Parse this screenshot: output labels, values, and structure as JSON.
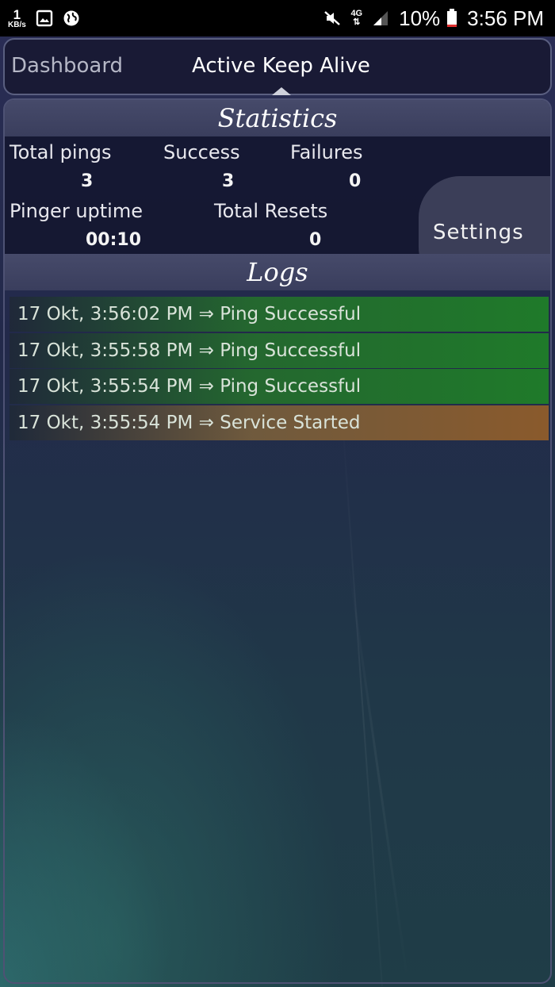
{
  "status_bar": {
    "speed_value": "1",
    "speed_unit": "KB/s",
    "network_type": "4G",
    "battery_percent": "10%",
    "clock": "3:56 PM",
    "icons": [
      "image-icon",
      "globe-icon",
      "mute-icon",
      "signal-icon",
      "battery-icon"
    ]
  },
  "nav": {
    "tabs": [
      {
        "label": "Dashboard",
        "active": false
      },
      {
        "label": "Active Keep Alive",
        "active": true
      }
    ]
  },
  "statistics": {
    "title": "Statistics",
    "total_pings": {
      "label": "Total pings",
      "value": "3"
    },
    "success": {
      "label": "Success",
      "value": "3"
    },
    "failures": {
      "label": "Failures",
      "value": "0"
    },
    "pinger_uptime": {
      "label": "Pinger uptime",
      "value": "00:10"
    },
    "total_resets": {
      "label": "Total Resets",
      "value": "0"
    },
    "settings_label": "Settings"
  },
  "logs": {
    "title": "Logs",
    "entries": [
      {
        "text": "17 Okt, 3:56:02 PM ⇒ Ping Successful",
        "status": "success"
      },
      {
        "text": "17 Okt, 3:55:58 PM ⇒ Ping Successful",
        "status": "success"
      },
      {
        "text": "17 Okt, 3:55:54 PM ⇒ Ping Successful",
        "status": "success"
      },
      {
        "text": "17 Okt, 3:55:54 PM ⇒ Service Started",
        "status": "start"
      }
    ]
  },
  "colors": {
    "success": "#1f7a2a",
    "started": "#8a5a2c",
    "header": "#3a3e5d"
  }
}
